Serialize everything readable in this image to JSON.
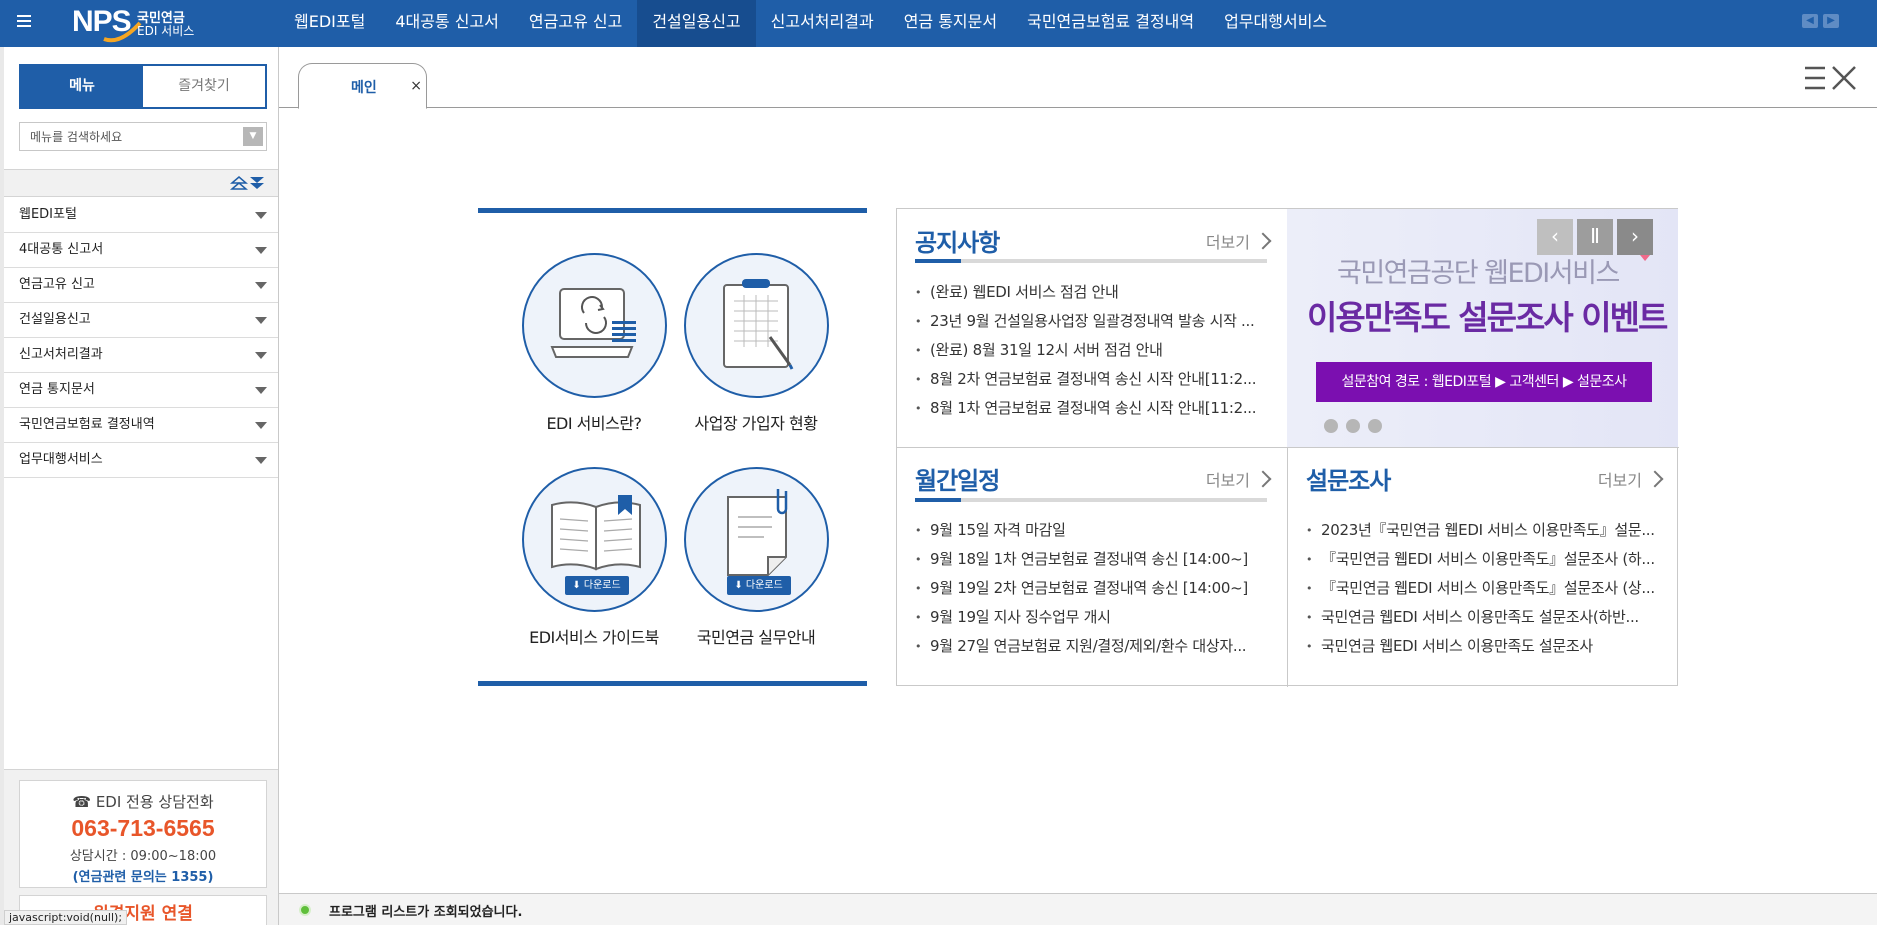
{
  "app": {
    "logo_text": "NPS",
    "logo_sub1": "국민연금",
    "logo_sub2": "EDI 서비스"
  },
  "topnav": {
    "items": [
      {
        "label": "웹EDI포털"
      },
      {
        "label": "4대공통 신고서"
      },
      {
        "label": "연금고유 신고"
      },
      {
        "label": "건설일용신고"
      },
      {
        "label": "신고서처리결과"
      },
      {
        "label": "연금 통지문서"
      },
      {
        "label": "국민연금보험료 결정내역"
      },
      {
        "label": "업무대행서비스"
      }
    ],
    "active_index": 3
  },
  "sidebar": {
    "tabs": {
      "menu": "메뉴",
      "favorites": "즐겨찾기"
    },
    "search_placeholder": "메뉴를 검색하세요",
    "items": [
      {
        "label": "웹EDI포털"
      },
      {
        "label": "4대공통 신고서"
      },
      {
        "label": "연금고유 신고"
      },
      {
        "label": "건설일용신고"
      },
      {
        "label": "신고서처리결과"
      },
      {
        "label": "연금 통지문서"
      },
      {
        "label": "국민연금보험료 결정내역"
      },
      {
        "label": "업무대행서비스"
      }
    ],
    "contact": {
      "title": "☎ EDI 전용 상담전화",
      "phone": "063-713-6565",
      "hours": "상담시간 : 09:00~18:00",
      "note": "(연금관련 문의는 1355)"
    },
    "remote": "원격지원 연결"
  },
  "tabs": {
    "main_label": "메인",
    "close_glyph": "×"
  },
  "quick": {
    "items": [
      {
        "label": "EDI 서비스란?",
        "icon": "laptop-refresh-icon"
      },
      {
        "label": "사업장 가입자 현황",
        "icon": "clipboard-grid-icon"
      },
      {
        "label": "EDI서비스 가이드북",
        "icon": "open-book-icon",
        "badge": "다운로드"
      },
      {
        "label": "국민연금 실무안내",
        "icon": "clipped-document-icon",
        "badge": "다운로드"
      }
    ]
  },
  "board": {
    "more_label": "더보기",
    "notice": {
      "title": "공지사항",
      "items": [
        "(완료) 웹EDI 서비스 점검 안내",
        "23년 9월 건설일용사업장 일괄경정내역 발송 시작 ...",
        "(완료) 8월 31일 12시 서버 점검 안내",
        "8월 2차 연금보험료 결정내역 송신 시작 안내[11:2...",
        "8월 1차 연금보험료 결정내역 송신 시작 안내[11:2..."
      ]
    },
    "schedule": {
      "title": "월간일정",
      "items": [
        "9월 15일 자격 마감일",
        "9월 18일 1차 연금보험료 결정내역 송신 [14:00~]",
        "9월 19일 2차 연금보험료 결정내역 송신 [14:00~]",
        "9월 19일 지사 징수업무 개시",
        "9월 27일 연금보험료 지원/결정/제외/환수 대상자..."
      ]
    },
    "survey": {
      "title": "설문조사",
      "items": [
        "2023년『국민연금 웹EDI 서비스 이용만족도』설문...",
        "『국민연금 웹EDI 서비스 이용만족도』설문조사 (하...",
        "『국민연금 웹EDI 서비스 이용만족도』설문조사 (상...",
        "국민연금 웹EDI 서비스 이용만족도 설문조사(하반...",
        "국민연금 웹EDI 서비스 이용만족도 설문조사"
      ]
    },
    "banner": {
      "line1": "국민연금공단 웹EDI서비스",
      "line2": "이용만족도 설문조사 이벤트",
      "button": "설문참여 경로 : 웹EDI포털 ▶ 고객센터 ▶ 설문조사",
      "prev": "‹",
      "pause": "Ⅱ",
      "next": "›"
    }
  },
  "status": {
    "message": "프로그램 리스트가 조회되었습니다.",
    "url_tip": "javascript:void(null);"
  },
  "colors": {
    "primary": "#1f5ea8",
    "accent": "#e8562a",
    "banner_purple": "#7b0fb0",
    "status_ok": "#5fbf3a"
  }
}
